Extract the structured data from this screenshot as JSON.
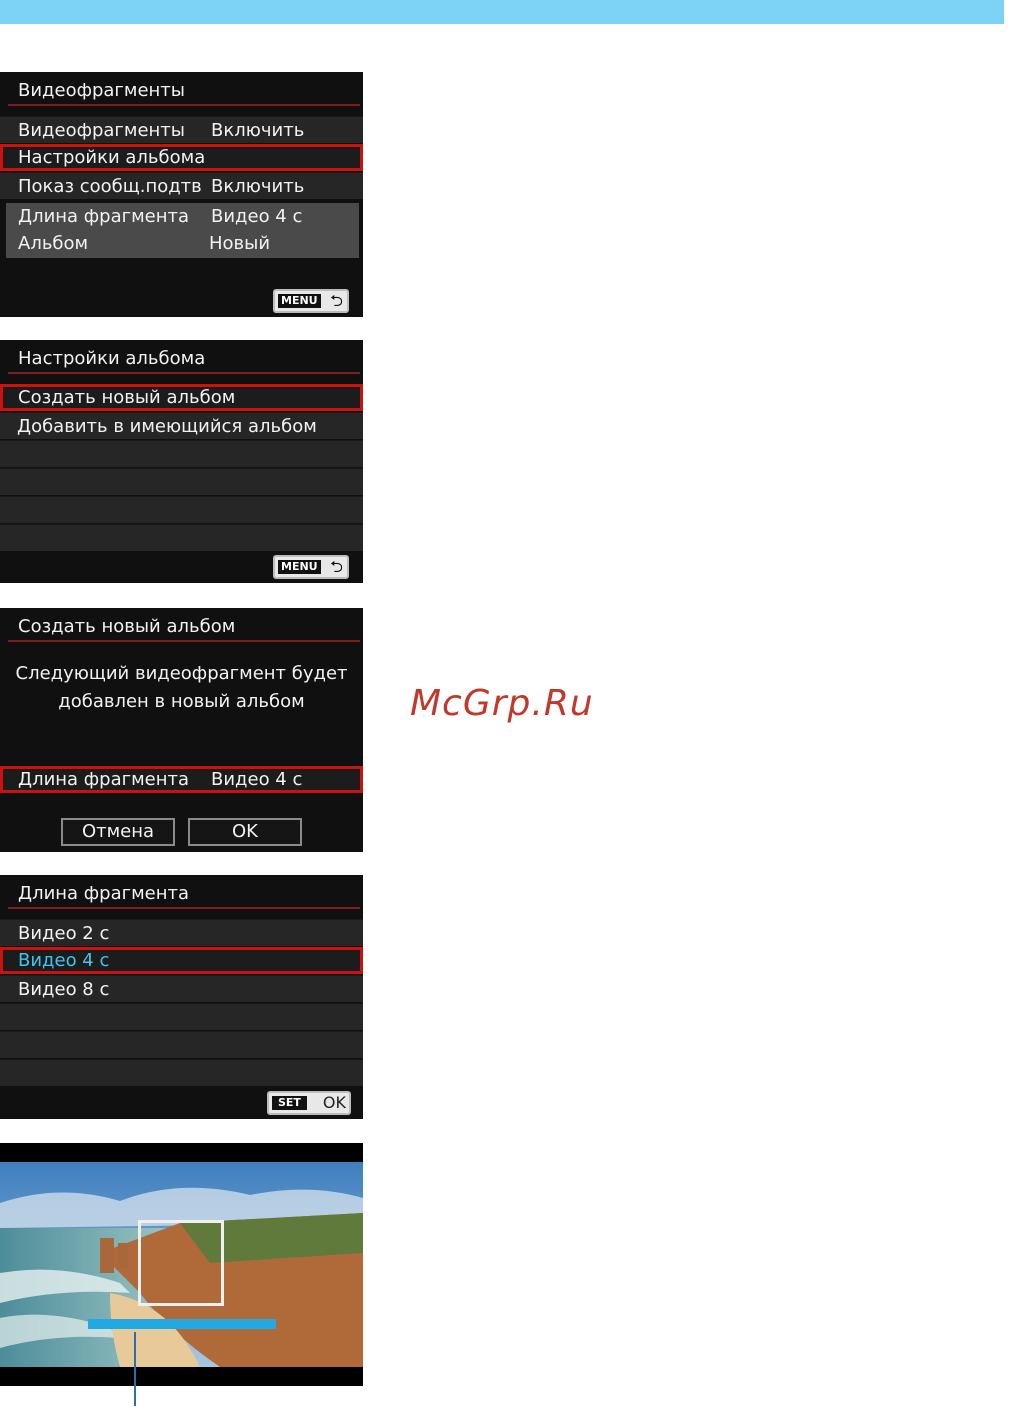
{
  "screen1": {
    "title": "Видеофрагменты",
    "rows": [
      {
        "label": "Видеофрагменты",
        "value": "Включить"
      },
      {
        "label": "Настройки альбома",
        "value": ""
      },
      {
        "label": "Показ сообщ.подтв",
        "value": "Включить"
      },
      {
        "label": "Длина фрагмента",
        "value": "Видео 4 с"
      },
      {
        "label": "Альбом",
        "value": "Новый"
      }
    ],
    "menu_button": "MENU"
  },
  "screen2": {
    "title": "Настройки альбома",
    "items": [
      "Создать новый альбом",
      "Добавить в имеющийся альбом"
    ],
    "menu_button": "MENU"
  },
  "screen3": {
    "title": "Создать новый альбом",
    "message_line1": "Следующий видеофрагмент будет",
    "message_line2": "добавлен в новый альбом",
    "row_label": "Длина фрагмента",
    "row_value": "Видео 4 с",
    "cancel": "Отмена",
    "ok": "OK"
  },
  "screen4": {
    "title": "Длина фрагмента",
    "items": [
      "Видео 2 с",
      "Видео 4 с",
      "Видео 8 с"
    ],
    "set_button": "SET",
    "set_ok": "OK"
  },
  "watermark": "McGrp.Ru",
  "progress_fraction": 1.0,
  "colors": {
    "top_bar": "#7dd3f5",
    "highlight_border": "#cc1111",
    "selected_text": "#3fc4ef",
    "progress_bar": "#23a9e1"
  }
}
